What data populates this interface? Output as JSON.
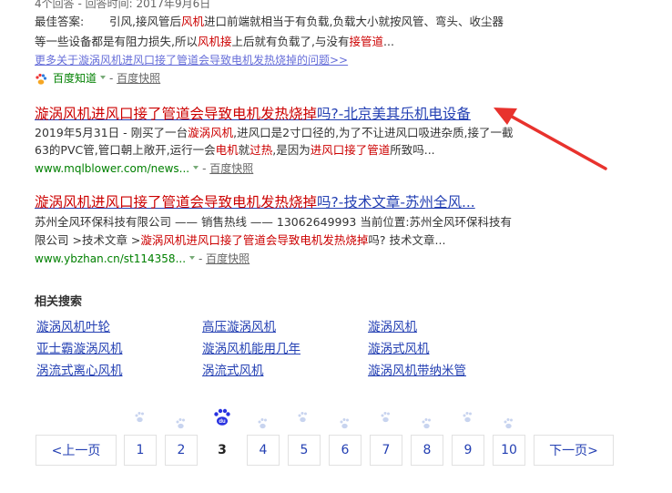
{
  "result0": {
    "meta": "4个回答 - 回答时间: 2017年9月6日",
    "answer_line1_prefix": "最佳答案:",
    "answer_line1_a": "引风,接风管后",
    "answer_line1_b": "风机",
    "answer_line1_c": "进口前端就相当于有负载,负载大小就按风管、弯头、收尘器",
    "answer_line2_a": "等一些设备都是有阻力损失,所以",
    "answer_line2_b": "风机接",
    "answer_line2_c": "上后就有负载了,与没有",
    "answer_line2_d": "接管道",
    "answer_line2_e": "...",
    "more_link": "更多关于漩涡风机进风口接了管道会导致电机发热烧掉的问题>>",
    "source": "百度知道",
    "snapshot": "百度快照"
  },
  "result1": {
    "title_a": "漩涡风机",
    "title_b": "进风口接了管道会导致电机发热烧掉",
    "title_c": "吗?-北京美其乐机电设备",
    "line1_a": "2019年5月31日 - 刚买了一台",
    "line1_b": "漩涡风机",
    "line1_c": ",进风口是2寸口径的,为了不让进风口吸进杂质,接了一截",
    "line2_a": "63的PVC管,管口朝上敞开,运行一会",
    "line2_b": "电机",
    "line2_c": "就",
    "line2_d": "过热",
    "line2_e": ",是因为",
    "line2_f": "进风口接了管道",
    "line2_g": "所致吗...",
    "url": "www.mqlblower.com/news...",
    "snapshot": "百度快照"
  },
  "result2": {
    "title_a": "漩涡风机",
    "title_b": "进风口接了管道会导致电机发热烧掉",
    "title_c": "吗?-技术文章-苏州全风...",
    "line1": "苏州全风环保科技有限公司 —— 销售热线 —— 13062649993 当前位置:苏州全风环保科技有",
    "line2_a": "限公司 >技术文章 >",
    "line2_b": "漩涡风机进风口接了管道会导致电机发热烧掉",
    "line2_c": "吗? 技术文章...",
    "url": "www.ybzhan.cn/st114358...",
    "snapshot": "百度快照"
  },
  "related": {
    "title": "相关搜索",
    "items": [
      "漩涡风机叶轮",
      "高压漩涡风机",
      "漩涡风机",
      "亚士霸漩涡风机",
      "漩涡风机能用几年",
      "漩涡式风机",
      "涡流式离心风机",
      "涡流式风机",
      "漩涡风机带纳米管"
    ]
  },
  "pagination": {
    "prev": "<上一页",
    "pages": [
      "1",
      "2",
      "3",
      "4",
      "5",
      "6",
      "7",
      "8",
      "9",
      "10"
    ],
    "current": "3",
    "next": "下一页>",
    "logo_text": "du"
  },
  "colors": {
    "link": "#2440b3",
    "highlight": "#c00000",
    "url_green": "#008000",
    "annotation_arrow": "#e8322d"
  }
}
